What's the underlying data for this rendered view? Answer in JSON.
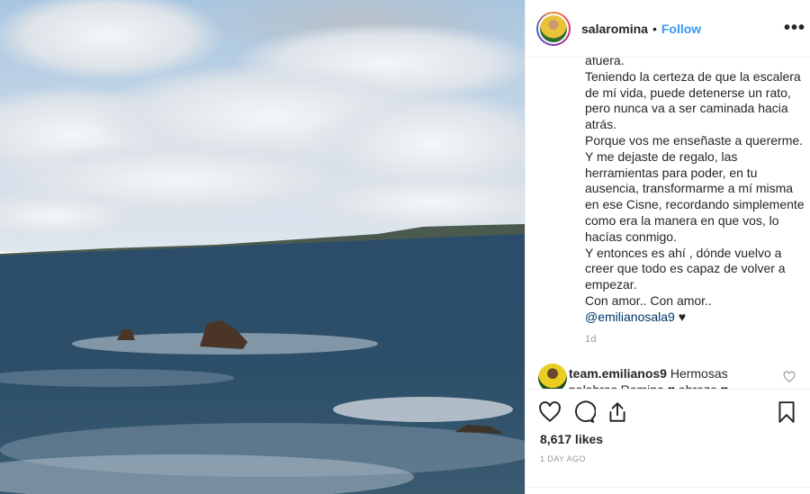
{
  "header": {
    "username": "salaromina",
    "separator": "•",
    "follow_label": "Follow",
    "more_label": "•••"
  },
  "caption": {
    "lines": [
      "afuera.",
      "Teniendo la certeza de que la escalera",
      "de mí vida, puede detenerse un rato,",
      "pero nunca va a ser caminada hacia",
      "atrás.",
      "Porque vos me enseñaste a quererme.",
      "Y me dejaste de regalo, las",
      "herramientas para poder, en tu",
      "ausencia, transformarme a mí misma",
      "en ese Cisne, recordando simplemente",
      "como era la manera en que vos, lo",
      "hacías conmigo.",
      "Y entonces es ahí , dónde vuelvo a",
      "creer que todo es capaz de volver a",
      "empezar.",
      "Con amor.. Con amor.."
    ],
    "mention": "@emilianosala9",
    "mention_suffix": " ♥",
    "time_ago": "1d"
  },
  "comment": {
    "username": "team.emilianos9",
    "text": "Hermosas palabras Romina ♥ abrazo ♥"
  },
  "actions": {
    "likes": "8,617 likes",
    "date": "1 DAY AGO"
  },
  "icons": [
    "heart-icon",
    "comment-icon",
    "share-icon",
    "bookmark-icon",
    "more-icon"
  ],
  "colors": {
    "follow": "#3897f0",
    "mention": "#003569",
    "muted": "#999999"
  }
}
